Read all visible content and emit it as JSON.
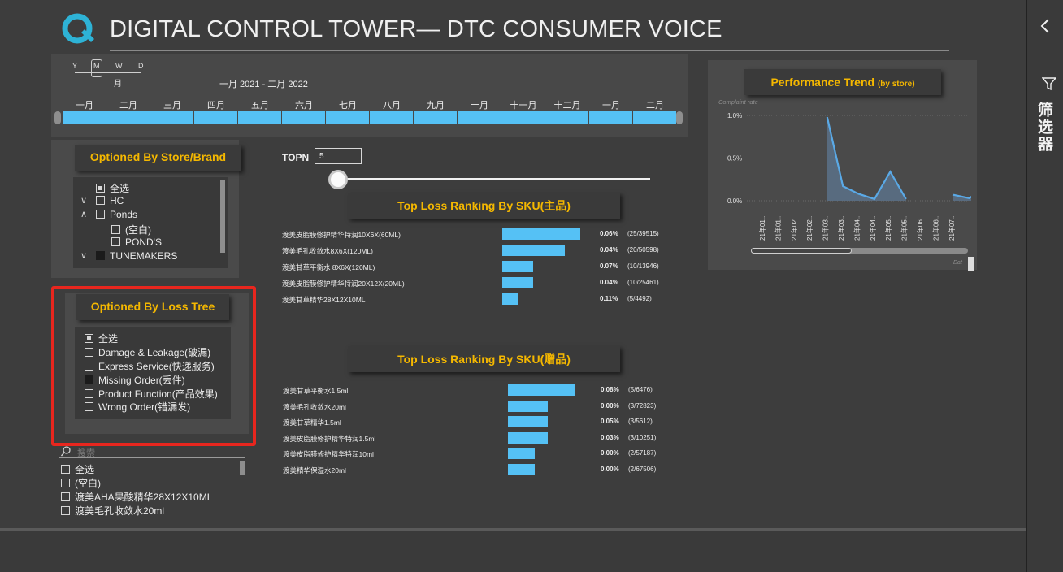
{
  "header": {
    "title": "DIGITAL CONTROL TOWER— DTC CONSUMER VOICE"
  },
  "timeline": {
    "granularity": [
      "Y",
      "M",
      "W",
      "D"
    ],
    "granularity_selected": "M",
    "granularity_label": "月",
    "date_range": "一月 2021 - 二月 2022",
    "months": [
      "一月",
      "二月",
      "三月",
      "四月",
      "五月",
      "六月",
      "七月",
      "八月",
      "九月",
      "十月",
      "十一月",
      "十二月",
      "一月",
      "二月"
    ]
  },
  "store_slicer": {
    "title": "Optioned  By Store/Brand",
    "items": [
      "全选",
      "HC",
      "Ponds",
      "(空白)",
      "POND'S",
      "TUNEMAKERS"
    ]
  },
  "loss_slicer": {
    "title": "Optioned  By Loss Tree",
    "items": [
      "全选",
      "Damage & Leakage(破漏)",
      "Express Service(快递服务)",
      "Missing Order(丢件)",
      "Product Function(产品效果)",
      "Wrong Order(错漏发)"
    ]
  },
  "sku_slicer": {
    "search_placeholder": "搜索",
    "items": [
      "全选",
      "(空白)",
      "渡美AHA果酸精华28X12X10ML",
      "渡美毛孔收敛水20ml"
    ]
  },
  "topn": {
    "label": "TOPN",
    "value": "5",
    "slider_fraction": 0.02
  },
  "ranking_main": {
    "title": "Top Loss Ranking By SKU(主品)",
    "rows": [
      {
        "sku": "渡美皮脂膜修护精华特润10X6X(60ML)",
        "value": 25,
        "pct": "0.06%",
        "frac": "(25/39515)"
      },
      {
        "sku": "渡美毛孔收敛水8X6X(120ML)",
        "value": 20,
        "pct": "0.04%",
        "frac": "(20/50598)"
      },
      {
        "sku": "渡美甘草平衡水 8X6X(120ML)",
        "value": 10,
        "pct": "0.07%",
        "frac": "(10/13946)"
      },
      {
        "sku": "渡美皮脂膜修护精华特润20X12X(20ML)",
        "value": 10,
        "pct": "0.04%",
        "frac": "(10/25461)"
      },
      {
        "sku": "渡美甘草精华28X12X10ML",
        "value": 5,
        "pct": "0.11%",
        "frac": "(5/4492)"
      }
    ]
  },
  "ranking_gift": {
    "title": "Top Loss Ranking By SKU(赠品)",
    "rows": [
      {
        "sku": "渡美甘草平衡水1.5ml",
        "value": 5,
        "pct": "0.08%",
        "frac": "(5/6476)"
      },
      {
        "sku": "渡美毛孔收敛水20ml",
        "value": 3,
        "pct": "0.00%",
        "frac": "(3/72823)"
      },
      {
        "sku": "渡美甘草精华1.5ml",
        "value": 3,
        "pct": "0.05%",
        "frac": "(3/5612)"
      },
      {
        "sku": "渡美皮脂膜修护精华特润1.5ml",
        "value": 3,
        "pct": "0.03%",
        "frac": "(3/10251)"
      },
      {
        "sku": "渡美皮脂膜修护精华特润10ml",
        "value": 2,
        "pct": "0.00%",
        "frac": "(2/57187)"
      },
      {
        "sku": "渡美精华保湿水20ml",
        "value": 2,
        "pct": "0.00%",
        "frac": "(2/67506)"
      }
    ]
  },
  "trend": {
    "title": "Performance Trend",
    "title_suffix": "(by store)",
    "axis_title": "Complaint rate",
    "y_ticks": [
      "1.0%",
      "0.5%",
      "0.0%"
    ],
    "x_labels": [
      "21年01...",
      "21年01...",
      "21年02...",
      "21年02...",
      "21年03...",
      "21年03...",
      "21年04...",
      "21年04...",
      "21年05...",
      "21年05...",
      "21年06...",
      "21年06...",
      "21年07..."
    ],
    "values": [
      null,
      null,
      0.98,
      0.17,
      0.08,
      0.02,
      0.34,
      0.02,
      null,
      null,
      0.07,
      0.03,
      0.14
    ],
    "dat_label": "Dat"
  },
  "colors": {
    "accent": "#f5b800",
    "bar": "#55c1f5",
    "highlight": "#e8261e"
  },
  "filter_pane": {
    "label": "筛选器",
    "collapse_icon": "chevron-left-icon",
    "filter_icon": "funnel-icon"
  },
  "chart_data": [
    {
      "type": "bar",
      "title": "Top Loss Ranking By SKU(主品)",
      "categories": [
        "渡美皮脂膜修护精华特润10X6X(60ML)",
        "渡美毛孔收敛水8X6X(120ML)",
        "渡美甘草平衡水 8X6X(120ML)",
        "渡美皮脂膜修护精华特润20X12X(20ML)",
        "渡美甘草精华28X12X10ML"
      ],
      "values": [
        25,
        20,
        10,
        10,
        5
      ]
    },
    {
      "type": "bar",
      "title": "Top Loss Ranking By SKU(赠品)",
      "categories": [
        "渡美甘草平衡水1.5ml",
        "渡美毛孔收敛水20ml",
        "渡美甘草精华1.5ml",
        "渡美皮脂膜修护精华特润1.5ml",
        "渡美皮脂膜修护精华特润10ml",
        "渡美精华保湿水20ml"
      ],
      "values": [
        5,
        3,
        3,
        3,
        2,
        2
      ]
    },
    {
      "type": "area",
      "title": "Performance Trend (by store)",
      "ylabel": "Complaint rate",
      "ylim": [
        0,
        1.0
      ],
      "x": [
        "21年01...",
        "21年01...",
        "21年02...",
        "21年02...",
        "21年03...",
        "21年03...",
        "21年04...",
        "21年04...",
        "21年05...",
        "21年05...",
        "21年06...",
        "21年06...",
        "21年07..."
      ],
      "values": [
        null,
        null,
        0.98,
        0.17,
        0.08,
        0.02,
        0.34,
        0.02,
        null,
        null,
        0.07,
        0.03,
        0.14
      ]
    }
  ]
}
